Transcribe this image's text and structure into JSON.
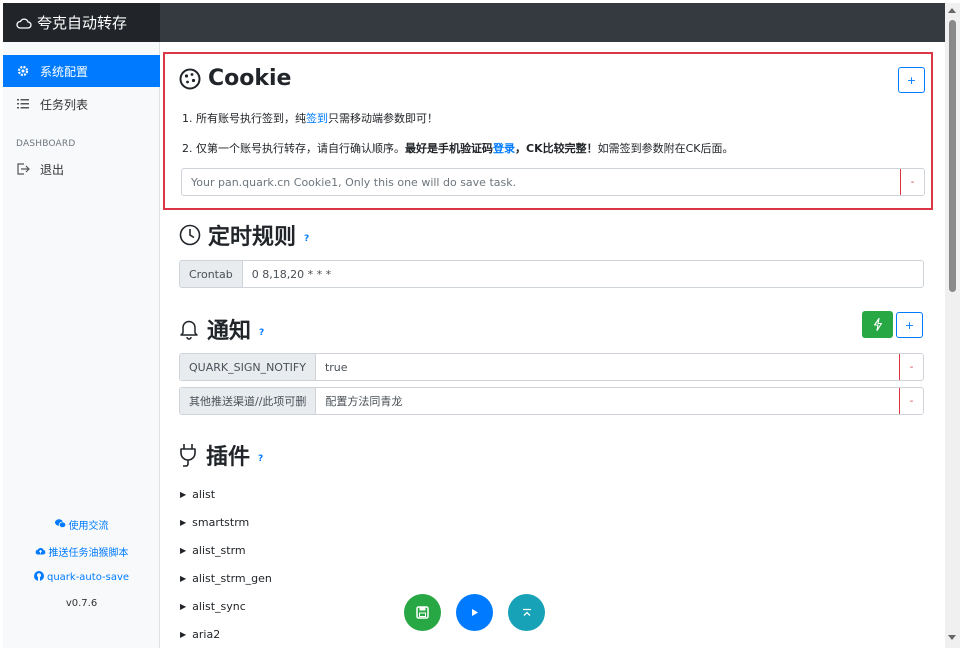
{
  "app": {
    "title": "夸克自动转存"
  },
  "sidebar": {
    "items": [
      {
        "label": "系统配置"
      },
      {
        "label": "任务列表"
      }
    ],
    "heading": "DASHBOARD",
    "logout": "退出",
    "links": [
      {
        "label": "使用交流"
      },
      {
        "label": "推送任务油猴脚本"
      },
      {
        "label": "quark-auto-save"
      }
    ],
    "version": "v0.7.6"
  },
  "cookie": {
    "title": "Cookie",
    "add": "+",
    "line1": {
      "pre": "1. 所有账号执行签到，纯",
      "link": "签到",
      "post": "只需移动端参数即可！"
    },
    "line2": {
      "pre": "2. 仅第一个账号执行转存，请自行确认顺序。",
      "bold1": "最好是手机验证码",
      "link": "登录",
      "bold2": "，CK比较完整！",
      "post": "如需签到参数附在CK后面。"
    },
    "placeholder": "Your pan.quark.cn Cookie1, Only this one will do save task.",
    "remove": "-"
  },
  "schedule": {
    "title": "定时规则",
    "help": "?",
    "addon": "Crontab",
    "value": "0 8,18,20 * * *"
  },
  "notify": {
    "title": "通知",
    "help": "?",
    "add": "+",
    "rows": [
      {
        "key": "QUARK_SIGN_NOTIFY",
        "value": "true",
        "remove": "-"
      },
      {
        "key": "其他推送渠道//此项可删",
        "value": "配置方法同青龙",
        "remove": "-"
      }
    ]
  },
  "plugins": {
    "title": "插件",
    "help": "?",
    "items": [
      "alist",
      "smartstrm",
      "alist_strm",
      "alist_strm_gen",
      "alist_sync",
      "aria2"
    ]
  },
  "colors": {
    "primary": "#007bff",
    "success": "#28a745",
    "danger": "#dc3545",
    "info": "#17a2b8",
    "navbar": "#343a40"
  }
}
